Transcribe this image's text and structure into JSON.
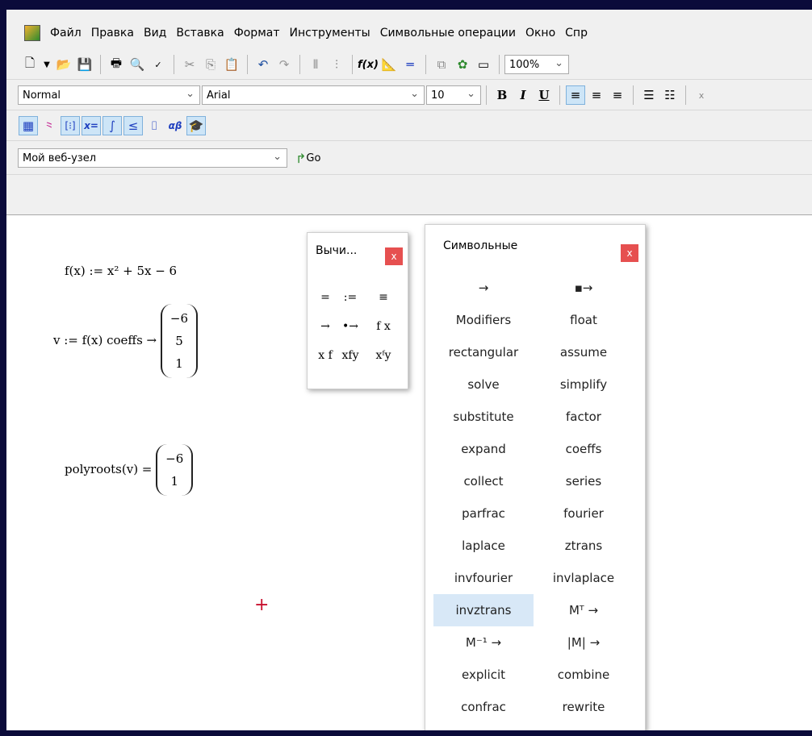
{
  "menu": {
    "items": [
      "Файл",
      "Правка",
      "Вид",
      "Вставка",
      "Формат",
      "Инструменты",
      "Символьные операции",
      "Окно",
      "Спр"
    ]
  },
  "standard_toolbar": {
    "icons": [
      "new-document-icon",
      "dropdown-arrow-icon",
      "open-folder-icon",
      "save-icon",
      "print-icon",
      "print-preview-icon",
      "spellcheck-icon",
      "cut-icon",
      "copy-icon",
      "paste-icon",
      "undo-icon",
      "redo-icon",
      "align-icon",
      "align-icon",
      "insert-function-icon",
      "insert-unit-icon",
      "calculate-icon",
      "component-icon",
      "resource-icon",
      "window-icon"
    ],
    "zoom": "100%"
  },
  "formatting_toolbar": {
    "style": "Normal",
    "font": "Arial",
    "size": "10",
    "bold": "B",
    "italic": "I",
    "underline": "U"
  },
  "math_toolbar": {
    "icons": [
      "calculator-icon",
      "graph-icon",
      "matrix-icon",
      "evaluation-icon",
      "calculus-icon",
      "boolean-icon",
      "programming-icon",
      "greek-icon",
      "symbolic-icon"
    ],
    "evaluation_label": "x=",
    "greek_label": "αβ"
  },
  "web_toolbar": {
    "address": "Мой веб-узел",
    "go_label": "Go"
  },
  "worksheet": {
    "expr1": "f(x) := x² + 5x − 6",
    "expr2_prefix": "v := f(x) coeffs →",
    "vector_v": [
      "−6",
      "5",
      "1"
    ],
    "expr3_prefix": "polyroots(v) =",
    "vector_roots": [
      "−6",
      "1"
    ],
    "cursor": "+"
  },
  "eval_palette": {
    "title": "Вычи...",
    "close": "x",
    "buttons": [
      "=",
      ":=",
      "≡",
      "→",
      "•→",
      "f x",
      "x f",
      "xfy",
      "xᶠy"
    ]
  },
  "symbolic_palette": {
    "title": "Символьные",
    "close": "x",
    "buttons": [
      "→",
      "▪→",
      "Modifiers",
      "float",
      "rectangular",
      "assume",
      "solve",
      "simplify",
      "substitute",
      "factor",
      "expand",
      "coeffs",
      "collect",
      "series",
      "parfrac",
      "fourier",
      "laplace",
      "ztrans",
      "invfourier",
      "invlaplace",
      "invztrans",
      "Mᵀ →",
      "M⁻¹ →",
      "|M| →",
      "explicit",
      "combine",
      "confrac",
      "rewrite"
    ],
    "selected": "invztrans"
  },
  "colors": {
    "close_button": "#e65050",
    "selected_cell": "#d8e8f7",
    "cursor": "#c8102e"
  }
}
